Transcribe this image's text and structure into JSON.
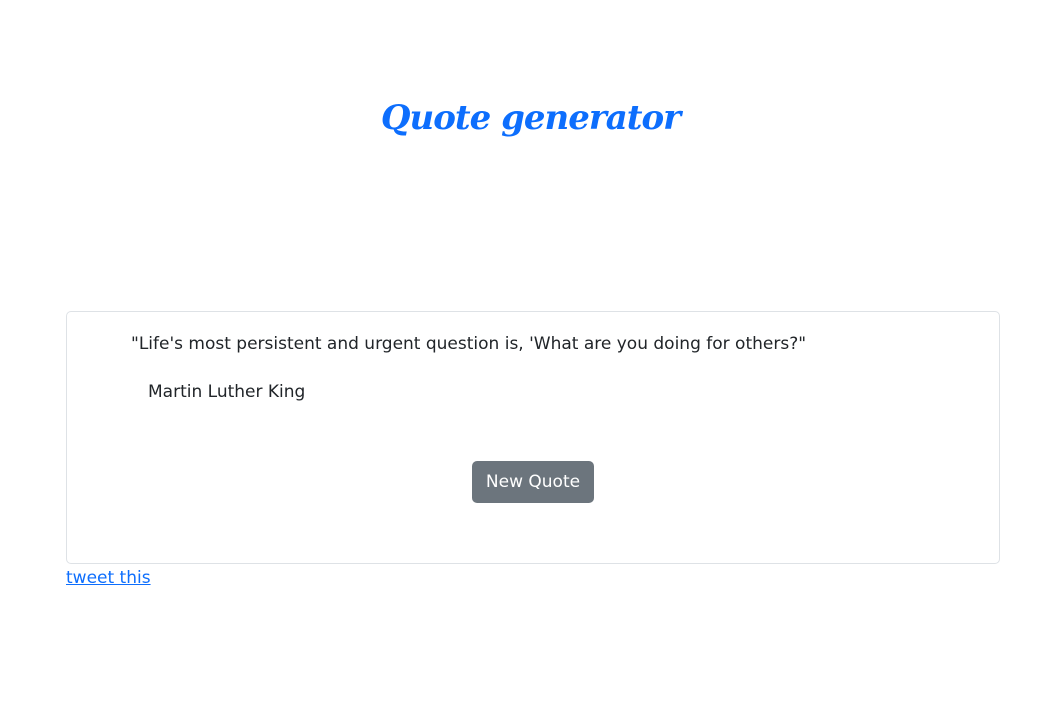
{
  "header": {
    "title": "Quote generator"
  },
  "quote": {
    "text": "\"Life's most persistent and urgent question is, 'What are you doing for others?\"",
    "author": "Martin Luther King"
  },
  "actions": {
    "new_quote_label": "New Quote",
    "tweet_label": "tweet this"
  },
  "colors": {
    "accent": "#0d6efd",
    "button_bg": "#6c757d",
    "card_border": "#dee2e6",
    "text": "#212529"
  }
}
